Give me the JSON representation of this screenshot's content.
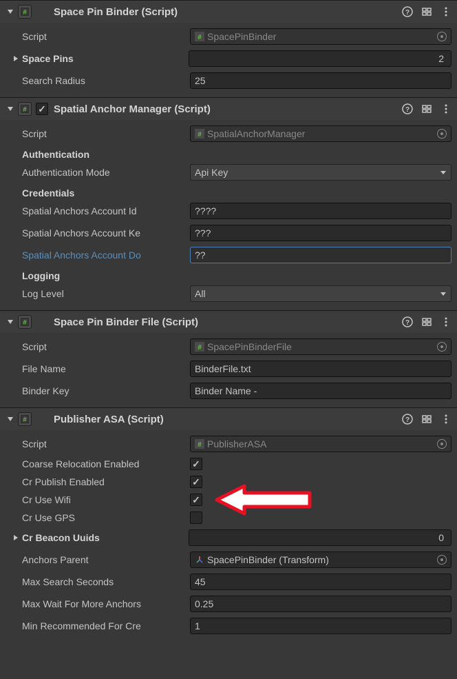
{
  "components": {
    "spacePinBinder": {
      "title": "Space Pin Binder (Script)",
      "script": {
        "label": "Script",
        "value": "SpacePinBinder"
      },
      "spacePins": {
        "label": "Space Pins",
        "value": "2"
      },
      "searchRadius": {
        "label": "Search Radius",
        "value": "25"
      }
    },
    "spatialAnchorManager": {
      "title": "Spatial Anchor Manager (Script)",
      "enabled": true,
      "script": {
        "label": "Script",
        "value": "SpatialAnchorManager"
      },
      "authentication": {
        "header": "Authentication",
        "mode": {
          "label": "Authentication Mode",
          "value": "Api Key"
        }
      },
      "credentials": {
        "header": "Credentials",
        "accountId": {
          "label": "Spatial Anchors Account Id",
          "value": "????"
        },
        "accountKey": {
          "label": "Spatial Anchors Account Ke",
          "value": "???"
        },
        "accountDomain": {
          "label": "Spatial Anchors Account Do",
          "value": "??"
        }
      },
      "logging": {
        "header": "Logging",
        "logLevel": {
          "label": "Log Level",
          "value": "All"
        }
      }
    },
    "spacePinBinderFile": {
      "title": "Space Pin Binder File (Script)",
      "script": {
        "label": "Script",
        "value": "SpacePinBinderFile"
      },
      "fileName": {
        "label": "File Name",
        "value": "BinderFile.txt"
      },
      "binderKey": {
        "label": "Binder Key",
        "value": "Binder Name -"
      }
    },
    "publisherASA": {
      "title": "Publisher ASA (Script)",
      "script": {
        "label": "Script",
        "value": "PublisherASA"
      },
      "coarseRelocation": {
        "label": "Coarse Relocation Enabled",
        "value": true
      },
      "crPublish": {
        "label": "Cr Publish Enabled",
        "value": true
      },
      "crUseWifi": {
        "label": "Cr Use Wifi",
        "value": true
      },
      "crUseGPS": {
        "label": "Cr Use GPS",
        "value": false
      },
      "crBeaconUuids": {
        "label": "Cr Beacon Uuids",
        "value": "0"
      },
      "anchorsParent": {
        "label": "Anchors Parent",
        "value": "SpacePinBinder (Transform)"
      },
      "maxSearchSeconds": {
        "label": "Max Search Seconds",
        "value": "45"
      },
      "maxWaitForMore": {
        "label": "Max Wait For More Anchors",
        "value": "0.25"
      },
      "minRecommended": {
        "label": "Min Recommended For Cre",
        "value": "1"
      }
    }
  }
}
